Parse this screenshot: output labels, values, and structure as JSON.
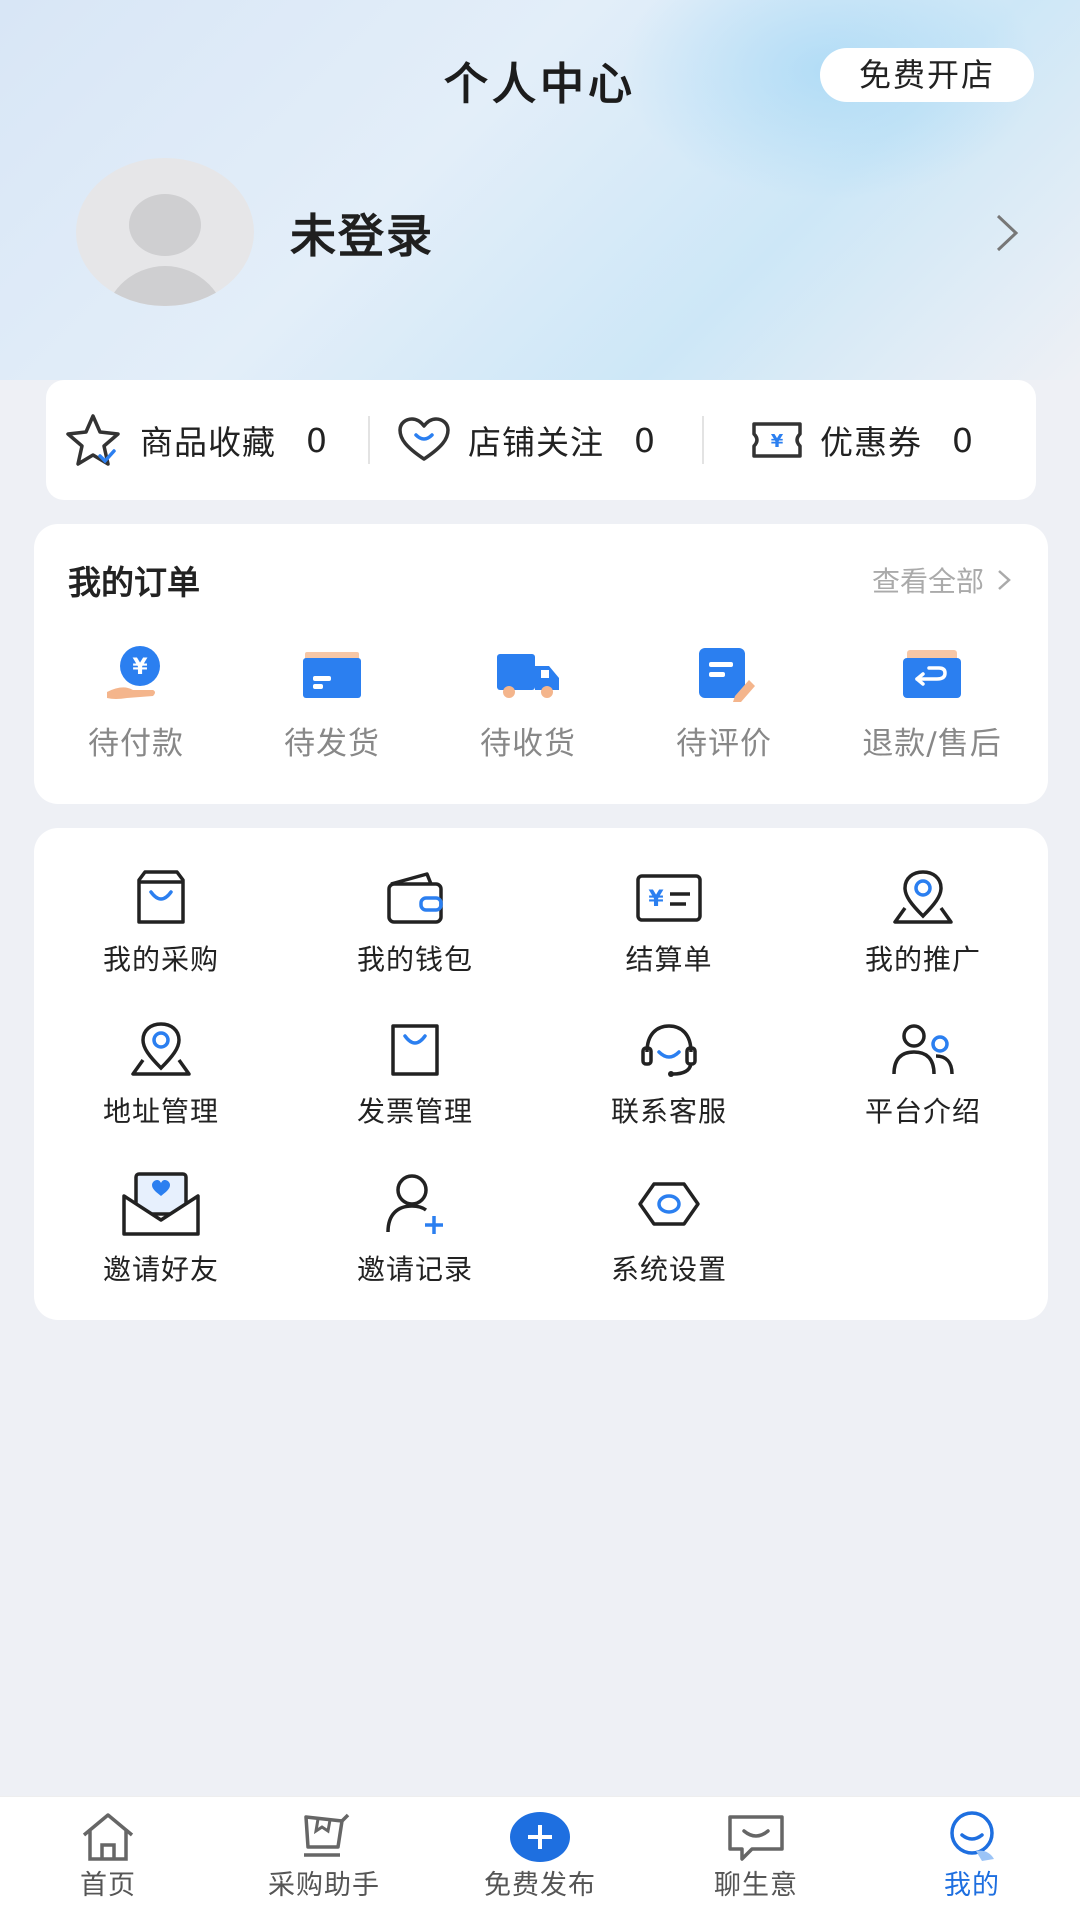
{
  "header": {
    "title": "个人中心",
    "open_store_label": "免费开店"
  },
  "profile": {
    "username": "未登录"
  },
  "stats": [
    {
      "label": "商品收藏",
      "count": "0",
      "icon": "star-icon"
    },
    {
      "label": "店铺关注",
      "count": "0",
      "icon": "heart-icon"
    },
    {
      "label": "优惠券",
      "count": "0",
      "icon": "coupon-icon"
    }
  ],
  "orders": {
    "title": "我的订单",
    "view_all": "查看全部",
    "items": [
      {
        "label": "待付款",
        "icon": "payment-pending-icon"
      },
      {
        "label": "待发货",
        "icon": "awaiting-shipment-icon"
      },
      {
        "label": "待收货",
        "icon": "delivery-truck-icon"
      },
      {
        "label": "待评价",
        "icon": "review-icon"
      },
      {
        "label": "退款/售后",
        "icon": "refund-icon"
      }
    ]
  },
  "menu": {
    "items": [
      {
        "label": "我的采购",
        "icon": "shopping-bag-icon"
      },
      {
        "label": "我的钱包",
        "icon": "wallet-icon"
      },
      {
        "label": "结算单",
        "icon": "settlement-icon"
      },
      {
        "label": "我的推广",
        "icon": "location-pin-icon"
      },
      {
        "label": "地址管理",
        "icon": "address-pin-icon"
      },
      {
        "label": "发票管理",
        "icon": "invoice-bag-icon"
      },
      {
        "label": "联系客服",
        "icon": "headset-icon"
      },
      {
        "label": "平台介绍",
        "icon": "people-icon"
      },
      {
        "label": "邀请好友",
        "icon": "invite-envelope-icon"
      },
      {
        "label": "邀请记录",
        "icon": "add-user-icon"
      },
      {
        "label": "系统设置",
        "icon": "settings-hexagon-icon"
      }
    ]
  },
  "tabbar": {
    "items": [
      {
        "label": "首页",
        "icon": "home-icon"
      },
      {
        "label": "采购助手",
        "icon": "cart-icon"
      },
      {
        "label": "免费发布",
        "icon": "plus-circle-icon"
      },
      {
        "label": "聊生意",
        "icon": "chat-icon"
      },
      {
        "label": "我的",
        "icon": "user-icon",
        "active": true
      }
    ]
  },
  "colors": {
    "accent": "#1e6fe0",
    "icon_blue": "#2b7ff0",
    "background": "#eef0f5"
  }
}
